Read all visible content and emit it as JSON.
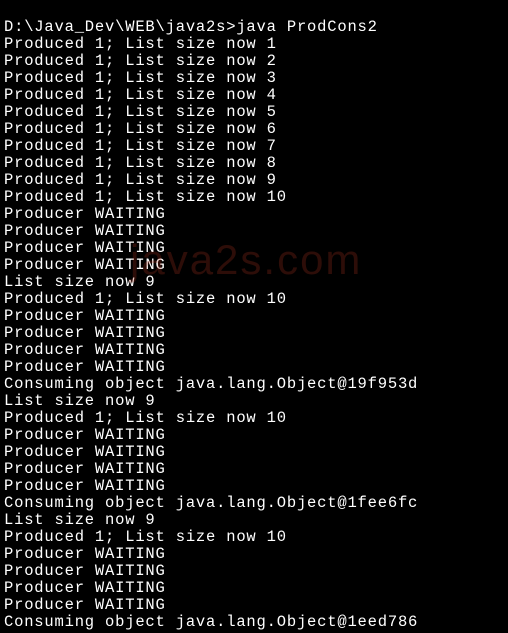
{
  "terminal": {
    "lines": [
      "D:\\Java_Dev\\WEB\\java2s>java ProdCons2",
      "Produced 1; List size now 1",
      "Produced 1; List size now 2",
      "Produced 1; List size now 3",
      "Produced 1; List size now 4",
      "Produced 1; List size now 5",
      "Produced 1; List size now 6",
      "Produced 1; List size now 7",
      "Produced 1; List size now 8",
      "Produced 1; List size now 9",
      "Produced 1; List size now 10",
      "Producer WAITING",
      "Producer WAITING",
      "Producer WAITING",
      "Producer WAITING",
      "List size now 9",
      "Produced 1; List size now 10",
      "Producer WAITING",
      "Producer WAITING",
      "Producer WAITING",
      "Producer WAITING",
      "Consuming object java.lang.Object@19f953d",
      "List size now 9",
      "Produced 1; List size now 10",
      "Producer WAITING",
      "Producer WAITING",
      "Producer WAITING",
      "Producer WAITING",
      "Consuming object java.lang.Object@1fee6fc",
      "List size now 9",
      "Produced 1; List size now 10",
      "Producer WAITING",
      "Producer WAITING",
      "Producer WAITING",
      "Producer WAITING",
      "Consuming object java.lang.Object@1eed786"
    ]
  },
  "watermark": {
    "text": "java2s.com"
  }
}
